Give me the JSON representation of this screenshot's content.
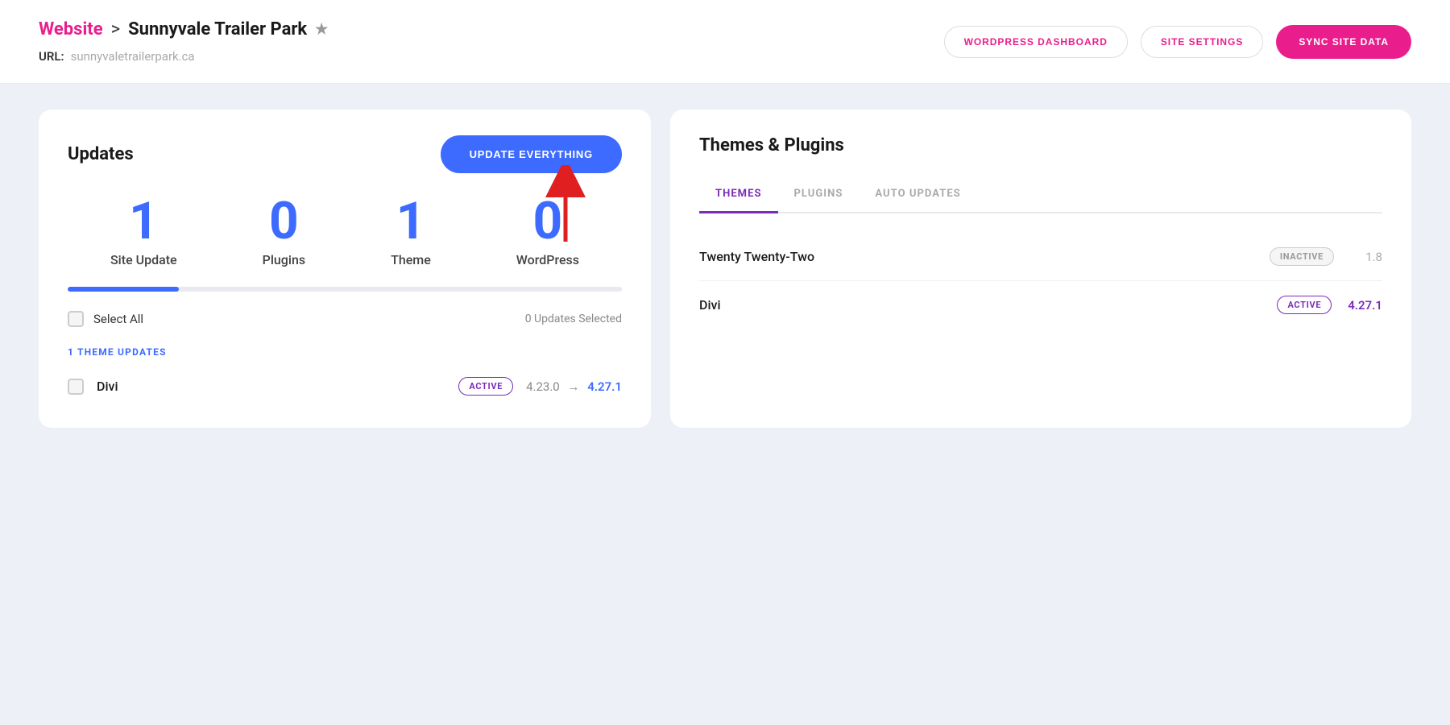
{
  "header": {
    "breadcrumb_website": "Website",
    "breadcrumb_separator": ">",
    "breadcrumb_site": "Sunnyvale Trailer Park",
    "breadcrumb_star": "★",
    "url_label": "URL:",
    "url_value": "sunnyvaletrailerpark.ca",
    "btn_wordpress_dashboard": "WORDPRESS DASHBOARD",
    "btn_site_settings": "SITE SETTINGS",
    "btn_sync_site_data": "SYNC SITE DATA"
  },
  "updates_panel": {
    "title": "Updates",
    "btn_update_everything": "UPDATE EVERYTHING",
    "stats": [
      {
        "number": "1",
        "label": "Site Update"
      },
      {
        "number": "0",
        "label": "Plugins"
      },
      {
        "number": "1",
        "label": "Theme"
      },
      {
        "number": "0",
        "label": "WordPress"
      }
    ],
    "select_all_label": "Select All",
    "updates_selected": "0 Updates Selected",
    "section_label": "1 THEME UPDATES",
    "theme_update": {
      "name": "Divi",
      "badge": "ACTIVE",
      "version_from": "4.23.0",
      "arrow": "→",
      "version_to": "4.27.1"
    }
  },
  "themes_plugins_panel": {
    "title": "Themes & Plugins",
    "tabs": [
      {
        "label": "THEMES",
        "active": true
      },
      {
        "label": "PLUGINS",
        "active": false
      },
      {
        "label": "AUTO UPDATES",
        "active": false
      }
    ],
    "themes": [
      {
        "name": "Twenty Twenty-Two",
        "status": "INACTIVE",
        "status_type": "inactive",
        "version": "1.8"
      },
      {
        "name": "Divi",
        "status": "ACTIVE",
        "status_type": "active",
        "version": "4.27.1"
      }
    ]
  }
}
